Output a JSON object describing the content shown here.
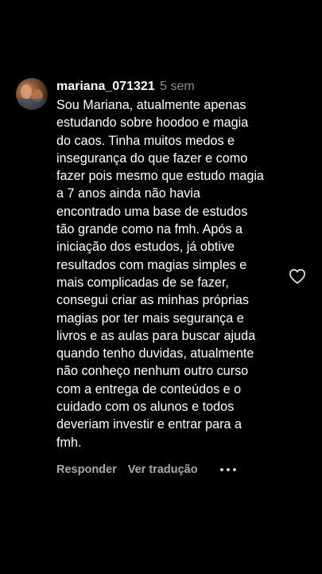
{
  "comment": {
    "username": "mariana_071321",
    "time": "5 sem",
    "lines": [
      "Sou Mariana, atualmente apenas",
      "estudando sobre hoodoo e magia",
      "do caos. Tinha muitos medos e",
      "insegurança do que fazer e como",
      "fazer pois mesmo que estudo magia",
      "a 7 anos ainda não havia",
      "encontrado uma base de estudos",
      "tão grande como na fmh. Após a",
      "iniciação dos estudos, já obtive",
      "resultados com magias simples e",
      "mais complicadas de se fazer,",
      "consegui criar as minhas próprias",
      "magias por ter mais segurança e",
      "livros e as aulas para buscar ajuda",
      "quando tenho duvidas, atualmente",
      "não conheço nenhum outro curso",
      "com a entrega de conteúdos e o",
      "cuidado com os alunos e todos",
      "deveriam investir e entrar para a",
      "fmh."
    ],
    "reply_label": "Responder",
    "translate_label": "Ver tradução",
    "more_icon": "ellipsis-icon",
    "like_icon": "heart-outline-icon",
    "avatar_icon": "user-avatar"
  },
  "colors": {
    "background": "#000000",
    "text": "#ffffff",
    "muted": "#8e8e8e"
  }
}
